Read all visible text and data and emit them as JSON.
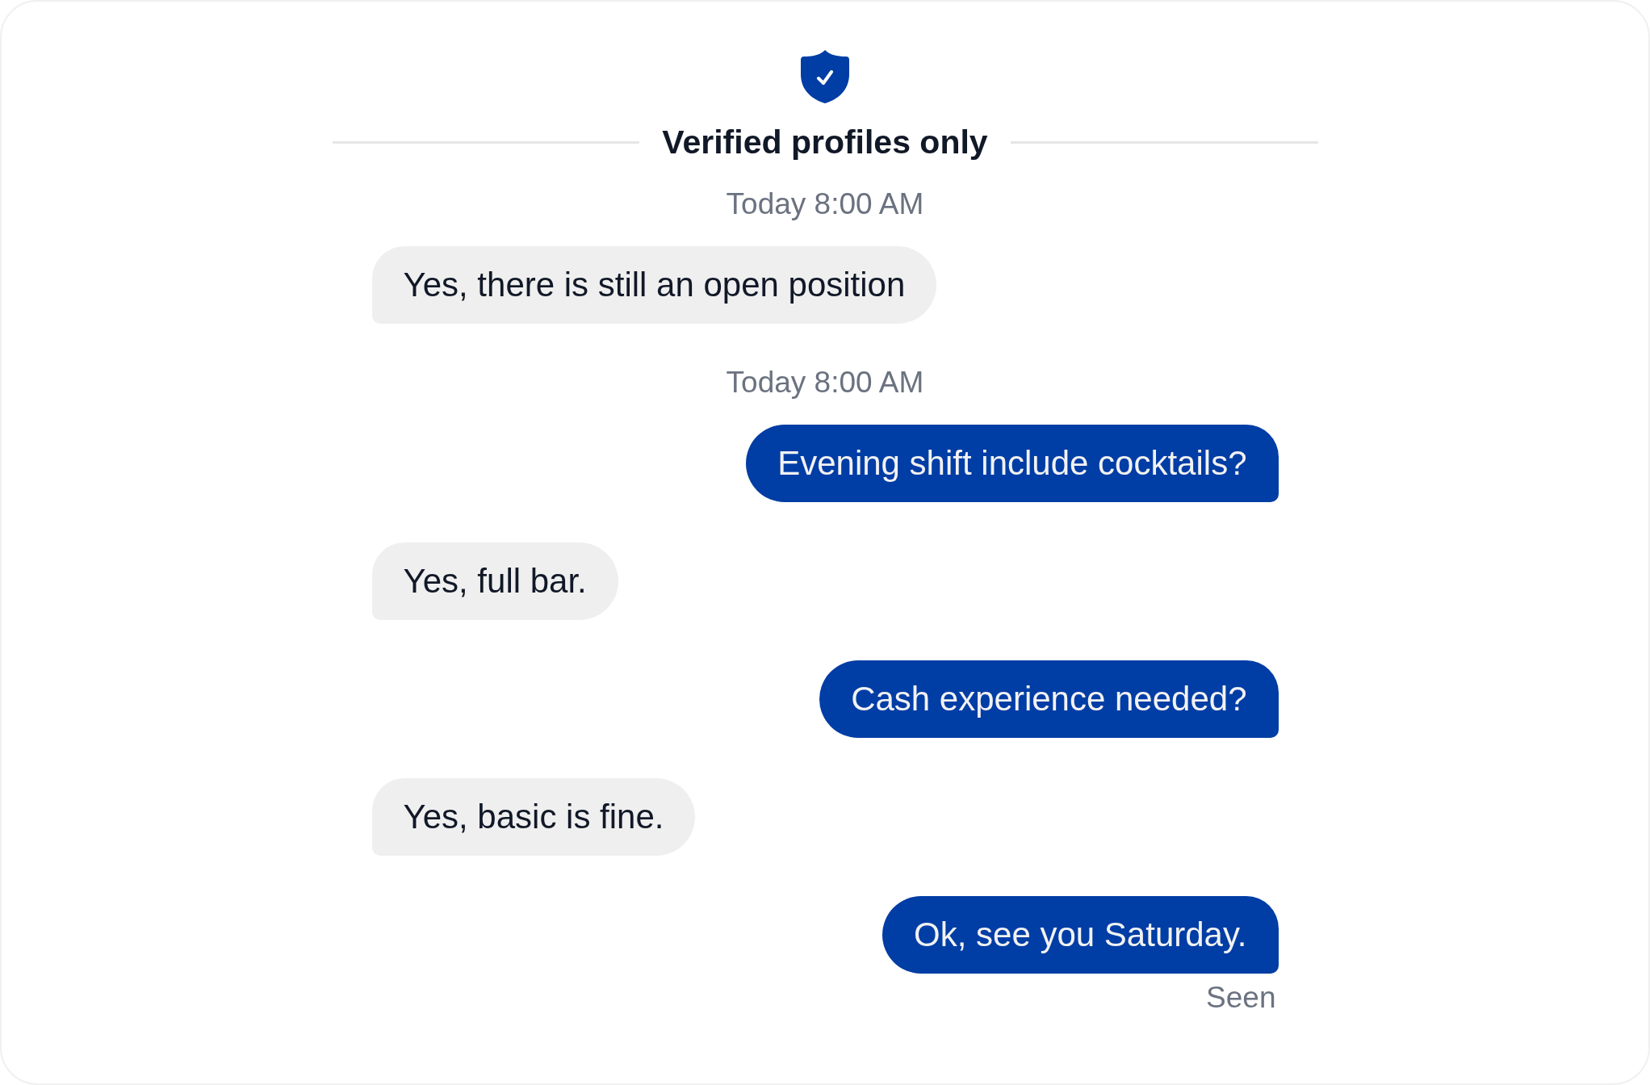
{
  "header": {
    "title": "Verified profiles only"
  },
  "thread": [
    {
      "kind": "timestamp",
      "text": "Today 8:00 AM"
    },
    {
      "kind": "received",
      "text": "Yes, there is still an open position"
    },
    {
      "kind": "timestamp",
      "text": "Today 8:00 AM"
    },
    {
      "kind": "sent",
      "text": "Evening shift include cocktails?"
    },
    {
      "kind": "received",
      "text": "Yes, full bar."
    },
    {
      "kind": "sent",
      "text": "Cash experience needed?"
    },
    {
      "kind": "received",
      "text": "Yes, basic is fine."
    },
    {
      "kind": "sent",
      "text": "Ok, see you Saturday."
    }
  ],
  "receipt": "Seen"
}
